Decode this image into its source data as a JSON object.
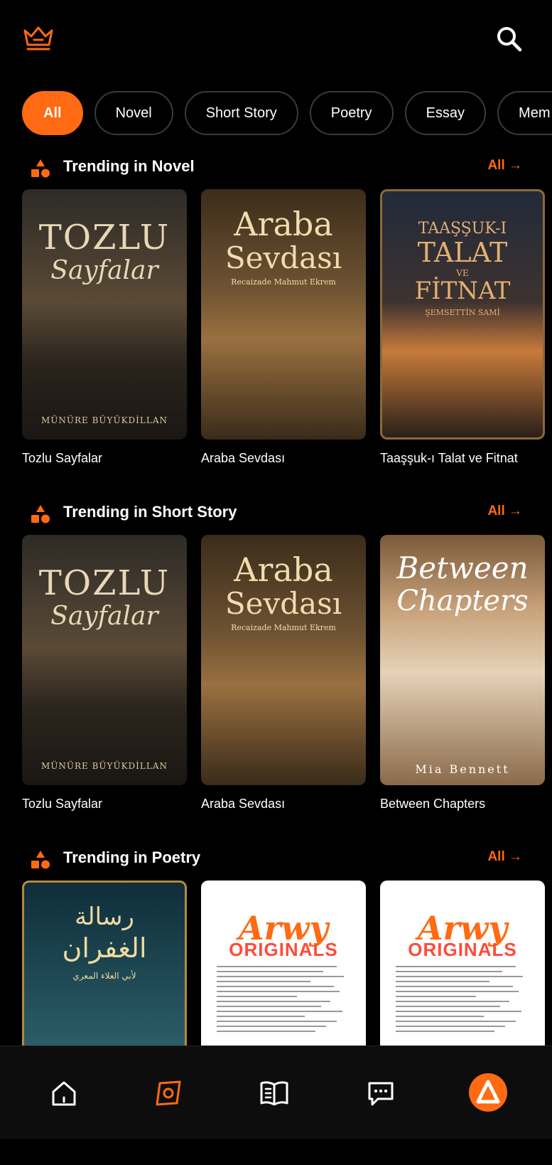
{
  "header": {
    "logo_icon": "crown-icon",
    "search_icon": "search-icon"
  },
  "filters": [
    "All",
    "Novel",
    "Short Story",
    "Poetry",
    "Essay",
    "Mem"
  ],
  "active_filter": "All",
  "accent": "#ff6a13",
  "sections": [
    {
      "title": "Trending in Novel",
      "all_label": "All →",
      "books": [
        {
          "title": "Tozlu Sayfalar",
          "cover": {
            "line1": "TOZLU",
            "line2": "Sayfalar",
            "author": "MÜNÜRE BÜYÜKDİLLAN"
          }
        },
        {
          "title": "Araba Sevdası",
          "cover": {
            "line1": "Araba",
            "line2": "Sevdası",
            "author": "Recaizade Mahmut Ekrem"
          }
        },
        {
          "title": "Taaşşuk-ı Talat ve Fitnat",
          "cover": {
            "line1": "TAAŞŞUK-I",
            "line2": "TALAT",
            "line3": "VE",
            "line4": "FİTNAT",
            "author": "ŞEMSETTİN SAMİ"
          }
        }
      ]
    },
    {
      "title": "Trending in Short Story",
      "all_label": "All →",
      "books": [
        {
          "title": "Tozlu Sayfalar",
          "cover": {
            "line1": "TOZLU",
            "line2": "Sayfalar",
            "author": "MÜNÜRE BÜYÜKDİLLAN"
          }
        },
        {
          "title": "Araba Sevdası",
          "cover": {
            "line1": "Araba",
            "line2": "Sevdası",
            "author": "Recaizade Mahmut Ekrem"
          }
        },
        {
          "title": "Between Chapters",
          "cover": {
            "line1": "Between",
            "line2": "Chapters",
            "author": "Mia Bennett"
          }
        }
      ]
    },
    {
      "title": "Trending in Poetry",
      "all_label": "All →",
      "books": [
        {
          "title": "",
          "cover": {
            "line1": "رسالة",
            "line2": "الغفران",
            "author": "لأبي العلاء المعري"
          }
        },
        {
          "title": "",
          "cover": {
            "line1": "Arwy",
            "line2": "ORIGINALS"
          }
        },
        {
          "title": "",
          "cover": {
            "line1": "Arwy",
            "line2": "ORIGINALS"
          }
        }
      ]
    }
  ],
  "bottom_nav": [
    "home-icon",
    "discover-icon",
    "library-icon",
    "messages-icon",
    "arwy-profile-icon"
  ],
  "active_nav": "discover-icon"
}
